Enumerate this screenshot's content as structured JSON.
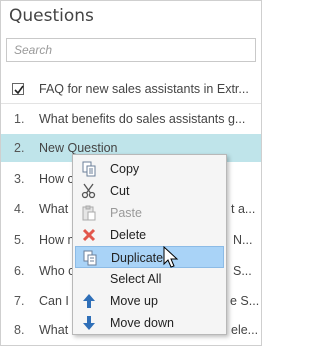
{
  "panel": {
    "title": "Questions",
    "search_placeholder": "Search"
  },
  "header_row": {
    "checked": true,
    "label": "FAQ for new sales assistants in Extr..."
  },
  "questions": [
    {
      "num": "1.",
      "text": "What benefits do sales assistants g..."
    },
    {
      "num": "2.",
      "text": "New Question"
    },
    {
      "num": "3.",
      "text": "How c"
    },
    {
      "num": "4.",
      "text": "What"
    },
    {
      "num": "5.",
      "text": "How m"
    },
    {
      "num": "6.",
      "text": "Who c"
    },
    {
      "num": "7.",
      "text": "Can I f"
    },
    {
      "num": "8.",
      "text": "What"
    }
  ],
  "questions_tail": {
    "4": "t a...",
    "5": "N...",
    "6": "S...",
    "7": "e S...",
    "8": "ele..."
  },
  "context_menu": {
    "items": [
      {
        "label": "Copy",
        "icon": "copy-icon",
        "disabled": false
      },
      {
        "label": "Cut",
        "icon": "scissors-icon",
        "disabled": false
      },
      {
        "label": "Paste",
        "icon": "paste-icon",
        "disabled": true
      },
      {
        "label": "Delete",
        "icon": "delete-x-icon",
        "disabled": false
      },
      {
        "label": "Duplicate",
        "icon": "duplicate-icon",
        "disabled": false,
        "hover": true
      },
      {
        "label": "Select All",
        "icon": "",
        "disabled": false
      },
      {
        "label": "Move up",
        "icon": "arrow-up-icon",
        "disabled": false
      },
      {
        "label": "Move down",
        "icon": "arrow-down-icon",
        "disabled": false
      }
    ]
  },
  "colors": {
    "selected_row": "#bfe4ea",
    "menu_hover": "#a9d3f7",
    "delete_icon": "#e2574c",
    "arrow_icon": "#2f6fb8"
  }
}
